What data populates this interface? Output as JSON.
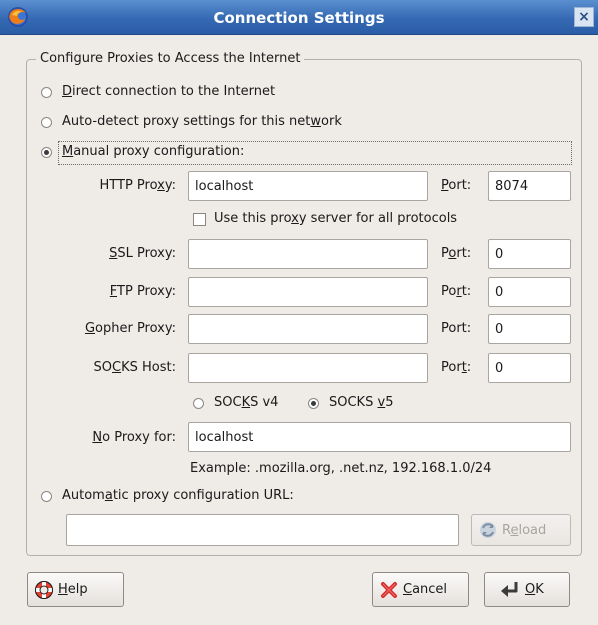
{
  "window": {
    "title": "Connection Settings",
    "close_glyph": "×"
  },
  "group": {
    "label": "Configure Proxies to Access the Internet"
  },
  "options": {
    "direct": {
      "pre": "",
      "key": "D",
      "post": "irect connection to the Internet",
      "checked": false
    },
    "auto_detect": {
      "pre": "Auto-detect proxy settings for this net",
      "key": "w",
      "post": "ork",
      "checked": false
    },
    "manual": {
      "pre": "",
      "key": "M",
      "post": "anual proxy configuration:",
      "checked": true
    },
    "auto_url": {
      "pre": "Autom",
      "key": "a",
      "post": "tic proxy configuration URL:",
      "checked": false
    }
  },
  "http": {
    "label_pre": "HTTP Pro",
    "label_key": "x",
    "label_post": "y:",
    "value": "localhost",
    "port_pre": "",
    "port_key": "P",
    "port_post": "ort:",
    "port": "8074"
  },
  "use_all": {
    "pre": "Use this pro",
    "key": "x",
    "post": "y server for all protocols",
    "checked": false
  },
  "ssl": {
    "label_pre": "",
    "label_key": "S",
    "label_post": "SL Proxy:",
    "value": "",
    "port_pre": "P",
    "port_key": "o",
    "port_post": "rt:",
    "port": "0"
  },
  "ftp": {
    "label_pre": "",
    "label_key": "F",
    "label_post": "TP Proxy:",
    "value": "",
    "port_pre": "Po",
    "port_key": "r",
    "port_post": "t:",
    "port": "0"
  },
  "gopher": {
    "label_pre": "",
    "label_key": "G",
    "label_post": "opher Proxy:",
    "value": "",
    "port_pre": "Port:",
    "port_key": "",
    "port_post": "",
    "port": "0"
  },
  "socks": {
    "label_pre": "SO",
    "label_key": "C",
    "label_post": "KS Host:",
    "value": "",
    "port_pre": "Por",
    "port_key": "t",
    "port_post": ":",
    "port": "0"
  },
  "socks_version": {
    "v4": {
      "pre": "SOC",
      "key": "K",
      "post": "S v4",
      "checked": false
    },
    "v5": {
      "pre": "SOCKS ",
      "key": "v",
      "post": "5",
      "checked": true
    }
  },
  "no_proxy": {
    "label_pre": "",
    "label_key": "N",
    "label_post": "o Proxy for:",
    "value": "localhost",
    "example": "Example: .mozilla.org, .net.nz, 192.168.1.0/24"
  },
  "auto_url_field": {
    "value": ""
  },
  "buttons": {
    "reload": {
      "pre": "R",
      "key": "e",
      "post": "load"
    },
    "help": {
      "pre": "",
      "key": "H",
      "post": "elp"
    },
    "cancel": {
      "pre": "",
      "key": "C",
      "post": "ancel"
    },
    "ok": {
      "pre": "",
      "key": "O",
      "post": "K"
    }
  },
  "icons": {
    "app": "firefox-icon",
    "reload": "reload-icon",
    "help": "lifebuoy-icon",
    "cancel": "red-x-icon",
    "ok": "enter-arrow-icon"
  },
  "colors": {
    "titlebar": "#3569b3",
    "window_bg": "#efebe7",
    "cancel_x": "#d62b2b"
  }
}
